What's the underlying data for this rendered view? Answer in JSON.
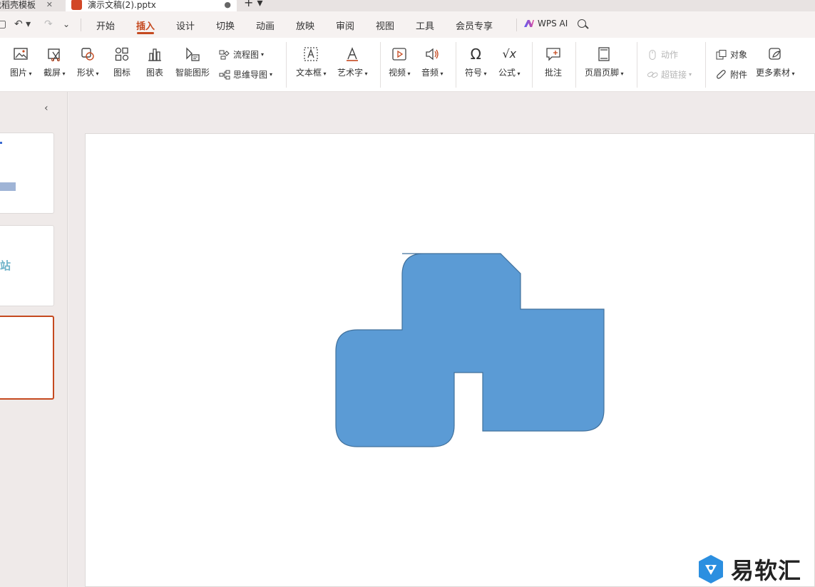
{
  "tabs": [
    {
      "label": "找稻壳模板",
      "active": false
    },
    {
      "label": "演示文稿(2).pptx",
      "active": true
    }
  ],
  "menu": {
    "items": [
      "开始",
      "插入",
      "设计",
      "切换",
      "动画",
      "放映",
      "审阅",
      "视图",
      "工具",
      "会员专享"
    ],
    "active": "插入",
    "wps_ai": "WPS AI"
  },
  "ribbon": {
    "picture": "图片",
    "screenshot": "截屏",
    "shape": "形状",
    "icon": "图标",
    "chart": "图表",
    "smartart": "智能图形",
    "flowchart": "流程图",
    "mindmap": "思维导图",
    "textbox": "文本框",
    "wordart": "艺术字",
    "video": "视频",
    "audio": "音频",
    "symbol": "符号",
    "formula": "公式",
    "comment": "批注",
    "header_footer": "页眉页脚",
    "action": "动作",
    "hyperlink": "超链接",
    "object": "对象",
    "attachment": "附件",
    "more": "更多素材"
  },
  "thumbnails": {
    "slide2_text": "站"
  },
  "shape": {
    "fill": "#5b9bd5",
    "stroke": "#41719c"
  },
  "watermark": "易软汇",
  "colors": {
    "accent": "#c5491f",
    "ppt_badge": "#d24726"
  }
}
